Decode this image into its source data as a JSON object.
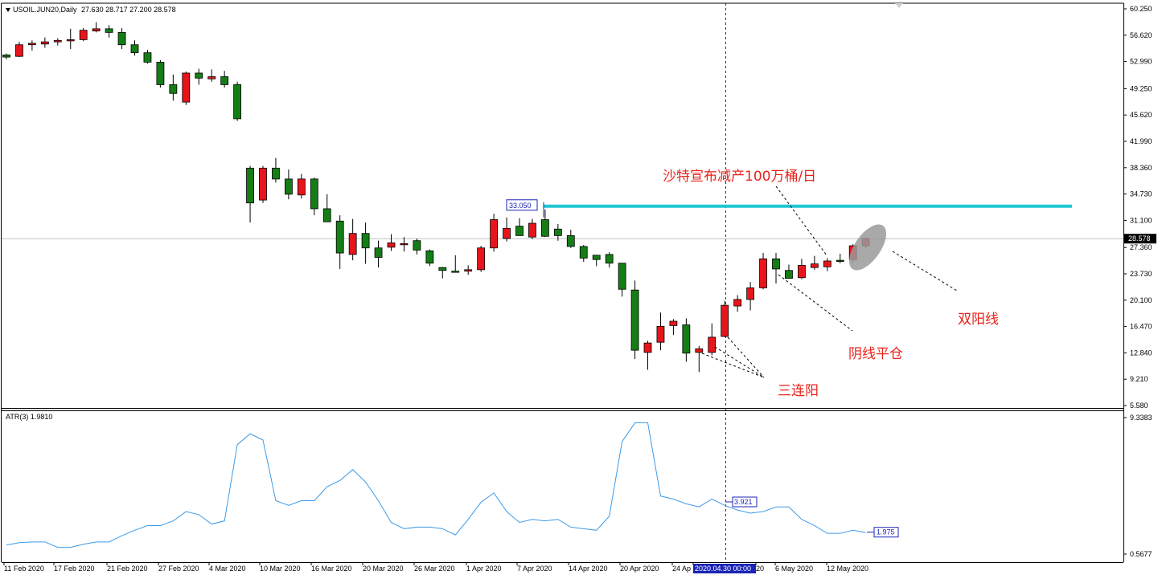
{
  "symbol_title": "USOIL.JUN20,Daily",
  "ohlc_values": "27.630 28.717 27.200 28.578",
  "indicator_title": "ATR(3) 1.9810",
  "annotations": {
    "saudi": "沙特宣布减产100万桶/日",
    "yinxian": "阴线平仓",
    "sanlianyang": "三连阳",
    "shuangyang": "双阳线"
  },
  "colors": {
    "up": "#e8141b",
    "down": "#157d15",
    "atr_line": "#3d9be9",
    "resistance": "#20c7d2",
    "crosshair": "#1a24b5"
  },
  "chart_data": [
    {
      "type": "candlestick",
      "price_axis_ticks": [
        "60.250",
        "56.620",
        "52.990",
        "49.250",
        "45.620",
        "41.990",
        "38.360",
        "34.730",
        "31.100",
        "27.360",
        "23.730",
        "20.100",
        "16.470",
        "12.840",
        "9.210",
        "5.580"
      ],
      "current_price": "28.578",
      "resistance_label": "33.050",
      "resistance_price": 33.05,
      "ylim": [
        5.58,
        60.25
      ],
      "x_tick_labels": [
        "11 Feb 2020",
        "17 Feb 2020",
        "21 Feb 2020",
        "27 Feb 2020",
        "4 Mar 2020",
        "10 Mar 2020",
        "16 Mar 2020",
        "20 Mar 2020",
        "26 Mar 2020",
        "1 Apr 2020",
        "7 Apr 2020",
        "14 Apr 2020",
        "20 Apr 2020",
        "24 Ap",
        "2020.04.30 00:00",
        "20",
        "6 May 2020",
        "12 May 2020"
      ],
      "candles": [
        [
          53.9,
          54.1,
          53.3,
          53.6
        ],
        [
          53.7,
          55.7,
          53.6,
          55.3
        ],
        [
          55.3,
          55.9,
          54.5,
          55.5
        ],
        [
          55.4,
          56.3,
          54.9,
          55.7
        ],
        [
          55.7,
          56.2,
          55.2,
          55.9
        ],
        [
          55.9,
          57.5,
          54.7,
          56.0
        ],
        [
          56.0,
          57.6,
          55.8,
          57.3
        ],
        [
          57.2,
          58.4,
          57.0,
          57.5
        ],
        [
          57.5,
          58.0,
          56.3,
          57.0
        ],
        [
          57.0,
          57.6,
          54.7,
          55.3
        ],
        [
          55.3,
          55.9,
          53.8,
          54.2
        ],
        [
          54.2,
          54.6,
          52.7,
          52.9
        ],
        [
          52.9,
          53.2,
          49.4,
          49.8
        ],
        [
          49.8,
          51.2,
          47.6,
          48.6
        ],
        [
          47.4,
          51.6,
          47.0,
          51.4
        ],
        [
          51.4,
          52.0,
          49.8,
          50.7
        ],
        [
          50.6,
          51.9,
          50.2,
          50.9
        ],
        [
          50.9,
          51.7,
          49.4,
          49.8
        ],
        [
          49.8,
          50.2,
          44.8,
          45.1
        ],
        [
          38.3,
          38.6,
          30.8,
          33.5
        ],
        [
          33.9,
          38.6,
          33.5,
          38.3
        ],
        [
          38.3,
          39.7,
          36.3,
          36.8
        ],
        [
          36.8,
          38.1,
          34.0,
          34.7
        ],
        [
          34.6,
          37.5,
          34.1,
          36.8
        ],
        [
          36.8,
          37.0,
          31.8,
          32.7
        ],
        [
          32.7,
          34.7,
          31.3,
          30.9
        ],
        [
          31.0,
          31.8,
          24.4,
          26.6
        ],
        [
          26.4,
          31.3,
          25.6,
          29.3
        ],
        [
          29.3,
          30.8,
          25.1,
          27.3
        ],
        [
          27.3,
          28.3,
          24.6,
          26.0
        ],
        [
          27.4,
          29.2,
          26.9,
          28.0
        ],
        [
          27.9,
          28.8,
          26.8,
          27.9
        ],
        [
          28.3,
          28.6,
          26.4,
          27.0
        ],
        [
          26.9,
          27.1,
          24.8,
          25.2
        ],
        [
          24.6,
          24.7,
          23.1,
          24.2
        ],
        [
          24.1,
          26.3,
          23.9,
          24.0
        ],
        [
          24.1,
          24.9,
          23.6,
          24.3
        ],
        [
          24.3,
          27.6,
          24.0,
          27.3
        ],
        [
          27.3,
          32.0,
          26.8,
          31.2
        ],
        [
          28.6,
          31.5,
          28.2,
          30.0
        ],
        [
          30.3,
          31.4,
          29.1,
          29.0
        ],
        [
          28.8,
          31.3,
          28.5,
          30.7
        ],
        [
          31.2,
          32.6,
          28.8,
          28.9
        ],
        [
          29.9,
          30.6,
          28.3,
          29.0
        ],
        [
          29.0,
          29.8,
          27.3,
          27.5
        ],
        [
          27.5,
          27.7,
          25.4,
          25.9
        ],
        [
          26.3,
          26.3,
          24.8,
          25.7
        ],
        [
          26.4,
          26.7,
          24.6,
          25.2
        ],
        [
          25.2,
          25.2,
          20.6,
          21.6
        ],
        [
          21.5,
          22.8,
          12.0,
          13.2
        ],
        [
          12.9,
          14.5,
          10.5,
          14.2
        ],
        [
          14.3,
          18.4,
          13.2,
          16.5
        ],
        [
          16.6,
          17.5,
          15.3,
          17.2
        ],
        [
          16.7,
          17.6,
          11.6,
          12.8
        ],
        [
          12.9,
          13.8,
          10.2,
          13.4
        ],
        [
          12.9,
          16.9,
          12.5,
          15.0
        ],
        [
          15.1,
          20.0,
          15.0,
          19.4
        ],
        [
          19.3,
          20.8,
          18.5,
          20.2
        ],
        [
          20.2,
          22.6,
          18.7,
          21.8
        ],
        [
          21.8,
          26.6,
          21.6,
          25.8
        ],
        [
          25.8,
          26.6,
          22.4,
          24.4
        ],
        [
          24.2,
          25.0,
          23.6,
          23.1
        ],
        [
          23.2,
          25.8,
          23.0,
          24.9
        ],
        [
          24.6,
          26.2,
          24.3,
          25.1
        ],
        [
          24.7,
          25.9,
          24.1,
          25.5
        ],
        [
          25.6,
          26.5,
          25.2,
          25.5
        ],
        [
          25.7,
          27.8,
          25.3,
          27.6
        ],
        [
          27.6,
          28.7,
          27.2,
          28.6
        ]
      ]
    },
    {
      "type": "line",
      "name": "ATR(3)",
      "last_value_label": "1.9810",
      "axis_ticks": [
        "9.3383",
        "0.5677"
      ],
      "ylim": [
        0.5677,
        9.3383
      ],
      "marker_labels": [
        "3.921",
        "1.975"
      ],
      "values": [
        1.15,
        1.3,
        1.35,
        1.35,
        1.0,
        1.0,
        1.2,
        1.35,
        1.35,
        1.75,
        2.1,
        2.4,
        2.4,
        2.7,
        3.3,
        3.1,
        2.5,
        2.7,
        7.6,
        8.3,
        7.9,
        4.0,
        3.7,
        4.0,
        4.0,
        4.9,
        5.3,
        6.0,
        5.2,
        4.0,
        2.6,
        2.2,
        2.3,
        2.3,
        2.2,
        1.8,
        2.8,
        3.9,
        4.5,
        3.3,
        2.6,
        2.8,
        2.7,
        2.8,
        2.3,
        2.2,
        2.1,
        3.0,
        7.8,
        9.0,
        9.0,
        4.3,
        4.1,
        3.8,
        3.6,
        4.1,
        3.7,
        3.4,
        3.2,
        3.3,
        3.6,
        3.6,
        2.8,
        2.4,
        1.9,
        1.9,
        2.1,
        1.95
      ]
    }
  ]
}
